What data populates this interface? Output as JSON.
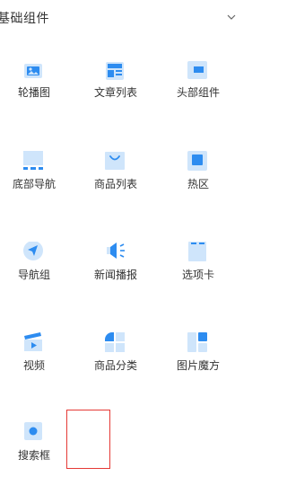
{
  "panel": {
    "title": "基础组件",
    "collapse_icon": "chevron-down-icon",
    "accent_color": "#2d8cf0",
    "light_color": "#cfe5fb",
    "items": [
      {
        "label": "轮播图",
        "icon": "image-carousel-icon"
      },
      {
        "label": "文章列表",
        "icon": "article-list-icon"
      },
      {
        "label": "头部组件",
        "icon": "header-component-icon"
      },
      {
        "label": "底部导航",
        "icon": "bottom-nav-icon"
      },
      {
        "label": "商品列表",
        "icon": "shopping-bag-icon"
      },
      {
        "label": "热区",
        "icon": "hotspot-icon"
      },
      {
        "label": "导航组",
        "icon": "navigation-arrow-icon"
      },
      {
        "label": "新闻播报",
        "icon": "broadcast-speaker-icon"
      },
      {
        "label": "选项卡",
        "icon": "tab-card-icon"
      },
      {
        "label": "视频",
        "icon": "video-clapper-icon"
      },
      {
        "label": "商品分类",
        "icon": "category-grid-icon"
      },
      {
        "label": "图片魔方",
        "icon": "image-cube-icon"
      },
      {
        "label": "搜索框",
        "icon": "search-box-icon"
      }
    ],
    "drop_target_color": "#e53935"
  }
}
